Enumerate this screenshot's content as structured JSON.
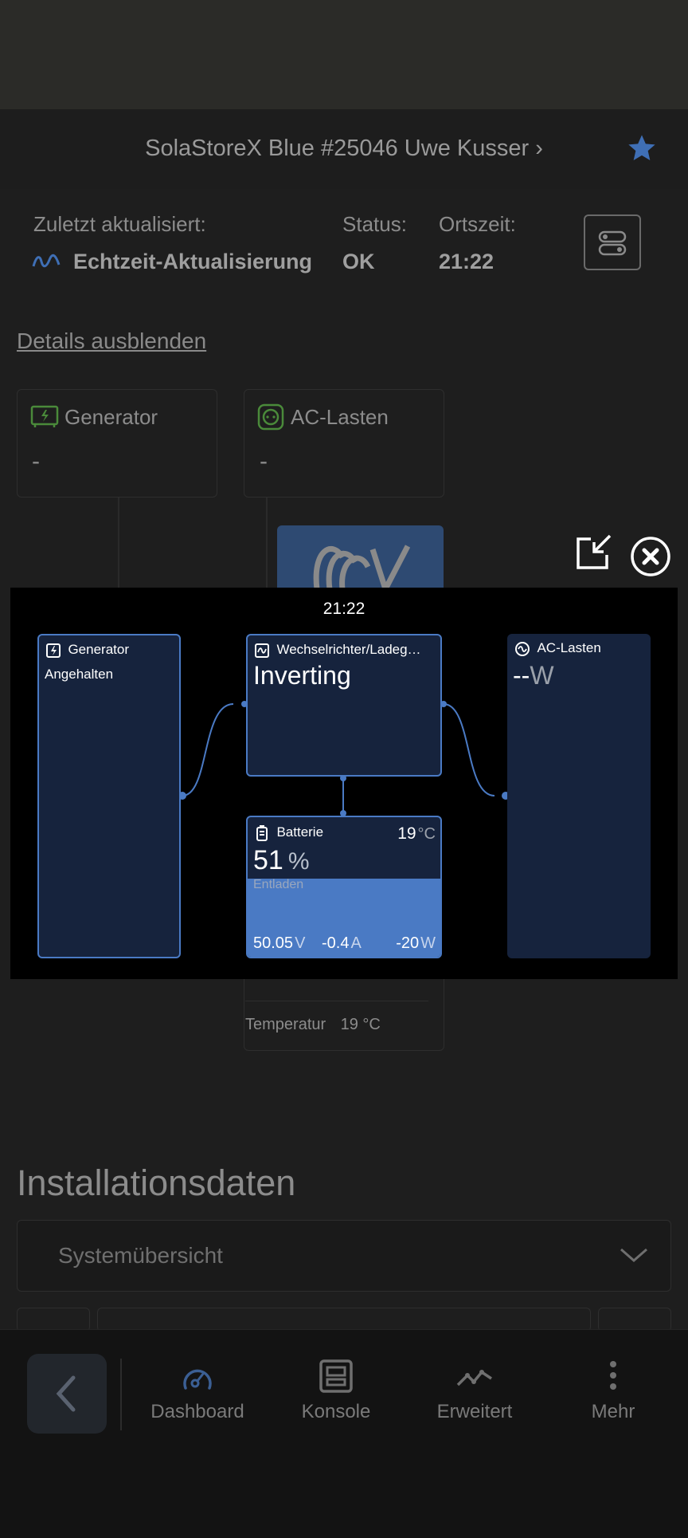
{
  "header": {
    "site_title": "SolaStoreX Blue #25046 Uwe Kusser ›"
  },
  "info": {
    "last_updated_label": "Zuletzt aktualisiert:",
    "last_updated_value": "Echtzeit-Aktualisierung",
    "status_label": "Status:",
    "status_value": "OK",
    "local_time_label": "Ortszeit:",
    "local_time_value": "21:22"
  },
  "details_link": "Details ausblenden",
  "cards": {
    "generator": {
      "title": "Generator",
      "value": "-"
    },
    "ac_loads": {
      "title": "AC-Lasten",
      "value": "-"
    },
    "temperature_label": "Temperatur",
    "temperature_value": "19 °C"
  },
  "console": {
    "time": "21:22",
    "generator": {
      "title": "Generator",
      "state": "Angehalten"
    },
    "inverter": {
      "title": "Wechselrichter/Ladeg…",
      "state": "Inverting"
    },
    "ac_loads": {
      "title": "AC-Lasten",
      "power": "--",
      "unit": "W"
    },
    "battery": {
      "title": "Batterie",
      "temp": "19",
      "temp_unit": "°C",
      "soc": "51",
      "soc_unit": "%",
      "state": "Entladen",
      "voltage": "50.05",
      "voltage_unit": "V",
      "current": "-0.4",
      "current_unit": "A",
      "power": "-20",
      "power_unit": "W",
      "soc_fraction": 0.51
    }
  },
  "installation": {
    "title": "Installationsdaten",
    "select_value": "Systemübersicht"
  },
  "nav": {
    "dashboard": "Dashboard",
    "console": "Konsole",
    "advanced": "Erweitert",
    "more": "Mehr"
  },
  "colors": {
    "accent": "#4a7ac4",
    "panel": "#16233d",
    "star": "#3f6fb5"
  }
}
